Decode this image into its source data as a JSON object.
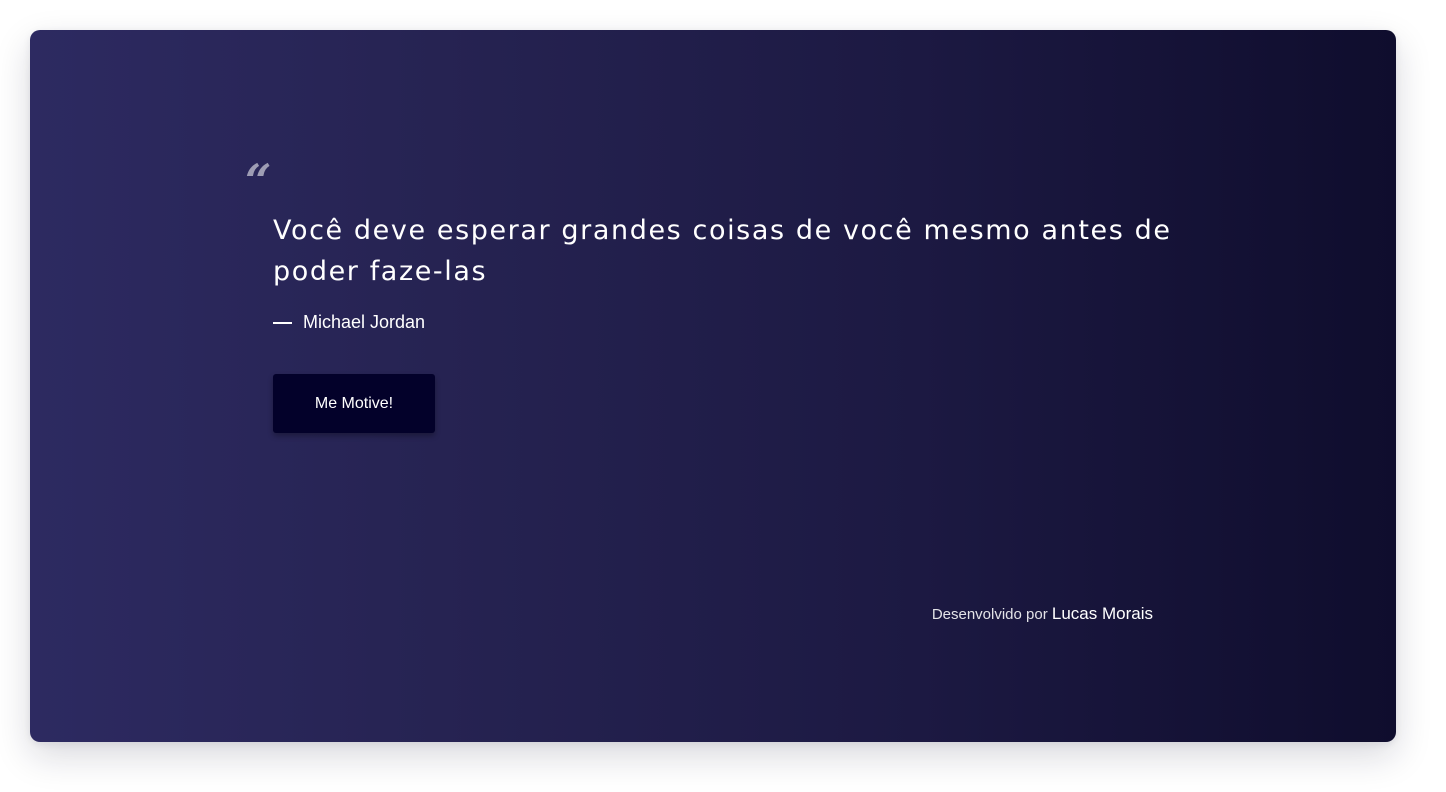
{
  "quote": {
    "mark": "“",
    "text": "Você deve esperar grandes coisas de você mesmo antes de poder faze-las",
    "author": "Michael Jordan"
  },
  "action": {
    "button_label": "Me Motive!"
  },
  "footer": {
    "prefix": "Desenvolvido por ",
    "author_name": "Lucas Morais"
  },
  "colors": {
    "gradient_start": "#2d2a61",
    "gradient_end": "#0f0d2d",
    "button_bg": "#03012a",
    "text": "#ffffff"
  }
}
